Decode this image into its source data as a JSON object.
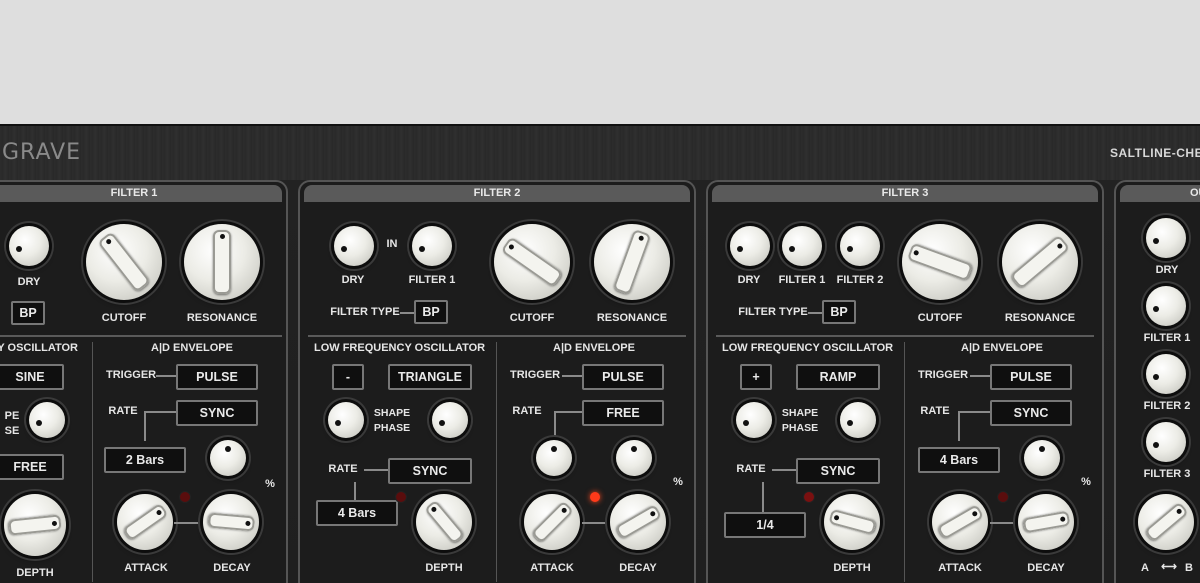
{
  "app": {
    "title": "GRAVE",
    "brand": "SALTLINE-CHES"
  },
  "filter1": {
    "title": "FILTER 1",
    "dry": "DRY",
    "cutoff": "CUTOFF",
    "resonance": "RESONANCE",
    "filter_type_value": "BP",
    "lfo_title": "Y OSCILLATOR",
    "lfo_wave": "SINE",
    "shape_phase_1": "PE",
    "shape_phase_2": "SE",
    "rate_value": "FREE",
    "depth": "DEPTH",
    "env_title": "A|D ENVELOPE",
    "trigger_label": "TRIGGER",
    "trigger_value": "PULSE",
    "rate_label": "RATE",
    "rate_mode": "SYNC",
    "rate_bars": "2 Bars",
    "attack": "ATTACK",
    "decay": "DECAY",
    "pct": "%"
  },
  "filter2": {
    "title": "FILTER 2",
    "dry": "DRY",
    "in_label": "IN",
    "filter1": "FILTER 1",
    "cutoff": "CUTOFF",
    "resonance": "RESONANCE",
    "filter_type_label": "FILTER TYPE",
    "filter_type_value": "BP",
    "lfo_title": "LOW FREQUENCY OSCILLATOR",
    "lfo_polarity": "-",
    "lfo_wave": "TRIANGLE",
    "shape": "SHAPE",
    "phase": "PHASE",
    "rate_label": "RATE",
    "rate_mode": "SYNC",
    "rate_bars": "4 Bars",
    "depth": "DEPTH",
    "env_title": "A|D ENVELOPE",
    "trigger_label": "TRIGGER",
    "trigger_value": "PULSE",
    "env_rate_label": "RATE",
    "env_rate_value": "FREE",
    "attack": "ATTACK",
    "decay": "DECAY",
    "pct": "%"
  },
  "filter3": {
    "title": "FILTER 3",
    "dry": "DRY",
    "filter1": "FILTER 1",
    "filter2": "FILTER 2",
    "cutoff": "CUTOFF",
    "resonance": "RESONANCE",
    "filter_type_label": "FILTER TYPE",
    "filter_type_value": "BP",
    "lfo_title": "LOW FREQUENCY OSCILLATOR",
    "lfo_polarity": "+",
    "lfo_wave": "RAMP",
    "shape": "SHAPE",
    "phase": "PHASE",
    "rate_label": "RATE",
    "rate_mode": "SYNC",
    "rate_value": "1/4",
    "depth": "DEPTH",
    "env_title": "A|D ENVELOPE",
    "trigger_label": "TRIGGER",
    "trigger_value": "PULSE",
    "env_rate_label": "RATE",
    "env_rate_mode": "SYNC",
    "env_rate_bars": "4 Bars",
    "attack": "ATTACK",
    "decay": "DECAY",
    "pct": "%"
  },
  "output": {
    "title": "OU",
    "dry": "DRY",
    "filter1": "FILTER 1",
    "filter2": "FILTER 2",
    "filter3": "FILTER 3",
    "ab_a": "A",
    "ab_b": "B"
  }
}
